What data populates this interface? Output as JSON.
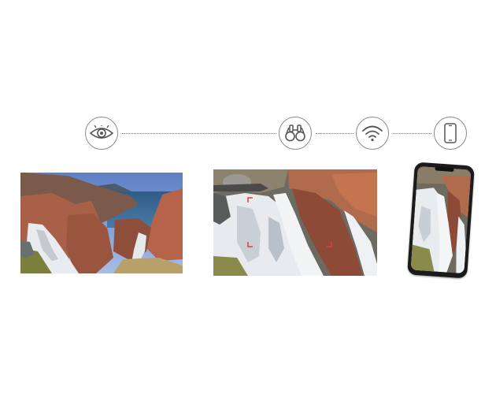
{
  "steps": [
    {
      "icon": "eye-icon"
    },
    {
      "icon": "binoculars-icon"
    },
    {
      "icon": "wifi-icon"
    },
    {
      "icon": "smartphone-icon"
    }
  ],
  "colors": {
    "icon_stroke": "#555555",
    "connector": "#7a7a7a",
    "focus_marker": "#e0413a"
  },
  "panels": [
    "landscape-photo",
    "zoomed-waterfall-photo",
    "phone-photo-preview"
  ]
}
